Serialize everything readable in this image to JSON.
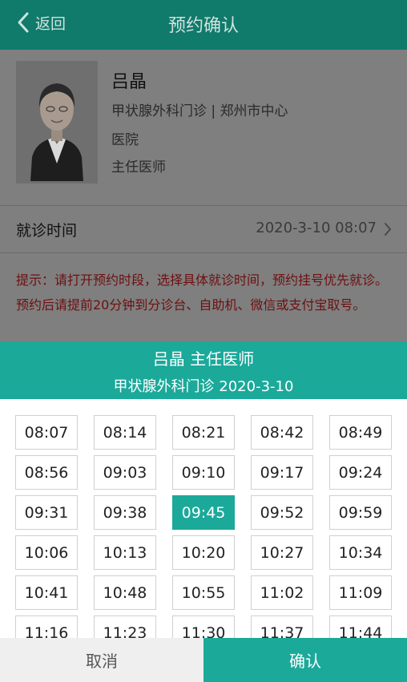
{
  "header": {
    "back_label": "返回",
    "title": "预约确认"
  },
  "doctor": {
    "name": "吕晶",
    "dept_line": "甲状腺外科门诊 | 郑州市中心",
    "dept_line_cont": "医院",
    "title": "主任医师"
  },
  "visit_time": {
    "label": "就诊时间",
    "value": "2020-3-10 08:07"
  },
  "notice": "提示：请打开预约时段，选择具体就诊时间，预约挂号优先就诊。预约后请提前20分钟到分诊台、自助机、微信或支付宝取号。",
  "popup": {
    "line1": "吕晶  主任医师",
    "line2": "甲状腺外科门诊  2020-3-10",
    "selected_slot": "09:45",
    "slots": [
      "08:07",
      "08:14",
      "08:21",
      "08:42",
      "08:49",
      "08:56",
      "09:03",
      "09:10",
      "09:17",
      "09:24",
      "09:31",
      "09:38",
      "09:45",
      "09:52",
      "09:59",
      "10:06",
      "10:13",
      "10:20",
      "10:27",
      "10:34",
      "10:41",
      "10:48",
      "10:55",
      "11:02",
      "11:09",
      "11:16",
      "11:23",
      "11:30",
      "11:37",
      "11:44"
    ]
  },
  "footer": {
    "cancel_label": "取消",
    "confirm_label": "确认"
  },
  "colors": {
    "header_bg": "#107a6b",
    "accent": "#1ba99a",
    "notice_text": "#6e0f0f"
  }
}
